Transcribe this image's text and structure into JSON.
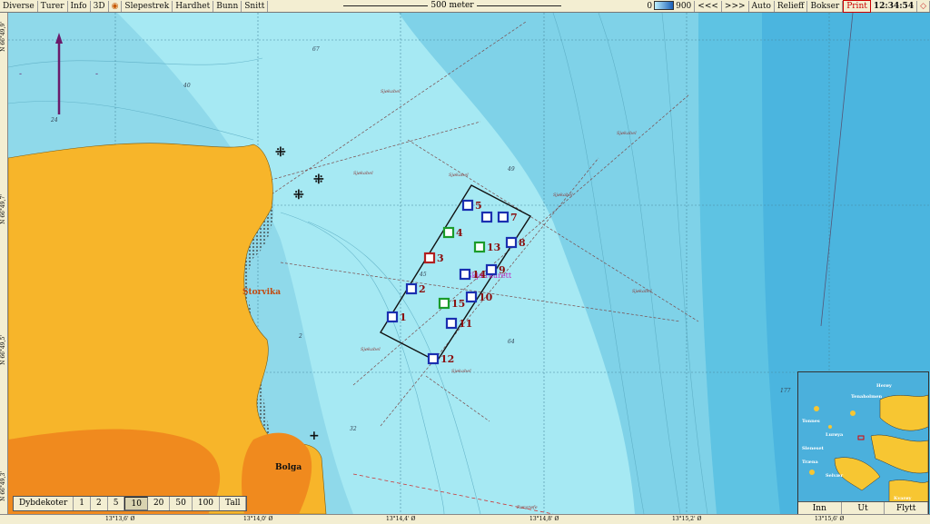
{
  "toolbar": {
    "items": [
      "Diverse",
      "Turer",
      "Info",
      "3D",
      "Slepestrek",
      "Hardhet",
      "Bunn",
      "Snitt"
    ],
    "scale": "500 meter",
    "depth_min": "0",
    "depth_max": "900",
    "nav_back": "<<<",
    "nav_fwd": ">>>",
    "auto": "Auto",
    "relieff": "Relieff",
    "bokser": "Bokser",
    "print": "Print",
    "clock": "12:34:54"
  },
  "map": {
    "place_storvika": "Storvika",
    "place_bolga": "Bolga",
    "area_label": "Skjæraurett",
    "cable_label": "Sjøkabel",
    "pipeline_label": "Rørgrøfe",
    "depth_values": [
      "67",
      "40",
      "24",
      "49",
      "45",
      "64",
      "2",
      "32",
      "177"
    ],
    "stations": [
      {
        "n": "1",
        "color": "blue"
      },
      {
        "n": "2",
        "color": "blue"
      },
      {
        "n": "3",
        "color": "red"
      },
      {
        "n": "4",
        "color": "green"
      },
      {
        "n": "5",
        "color": "blue"
      },
      {
        "n": "7",
        "color": "blue"
      },
      {
        "n": "8",
        "color": "blue"
      },
      {
        "n": "9",
        "color": "blue"
      },
      {
        "n": "10",
        "color": "blue"
      },
      {
        "n": "11",
        "color": "blue"
      },
      {
        "n": "12",
        "color": "blue"
      },
      {
        "n": "13",
        "color": "green"
      },
      {
        "n": "14",
        "color": "blue"
      },
      {
        "n": "15",
        "color": "green"
      }
    ]
  },
  "ruler": {
    "bottom": [
      "13°13,6' Ø",
      "13°14,0' Ø",
      "13°14,4' Ø",
      "13°14,8' Ø",
      "13°15,2' Ø",
      "13°15,6' Ø"
    ],
    "left": [
      "N 66°49,9'",
      "N 66°49,7'",
      "N 66°49,5'",
      "N 66°49,3'"
    ]
  },
  "dybdekoter": {
    "label": "Dybdekoter",
    "options": [
      "1",
      "2",
      "5",
      "10",
      "20",
      "50",
      "100",
      "Tall"
    ],
    "selected": "10"
  },
  "minimap": {
    "buttons": [
      "Inn",
      "Ut",
      "Flytt"
    ],
    "places": [
      "Herøy",
      "Tenaholmen",
      "Tonnes",
      "Lurøya",
      "Sleneset",
      "Træna",
      "Selvær",
      "Kvarøy"
    ]
  },
  "colors": {
    "land": "#f7b52a",
    "land_dark": "#f08a1e",
    "water_shallow": "#9ae6f0",
    "water_deep": "#3aa8d8",
    "station_blue": "#1a2fb0",
    "station_red": "#b22020",
    "station_green": "#1b9b2a"
  }
}
